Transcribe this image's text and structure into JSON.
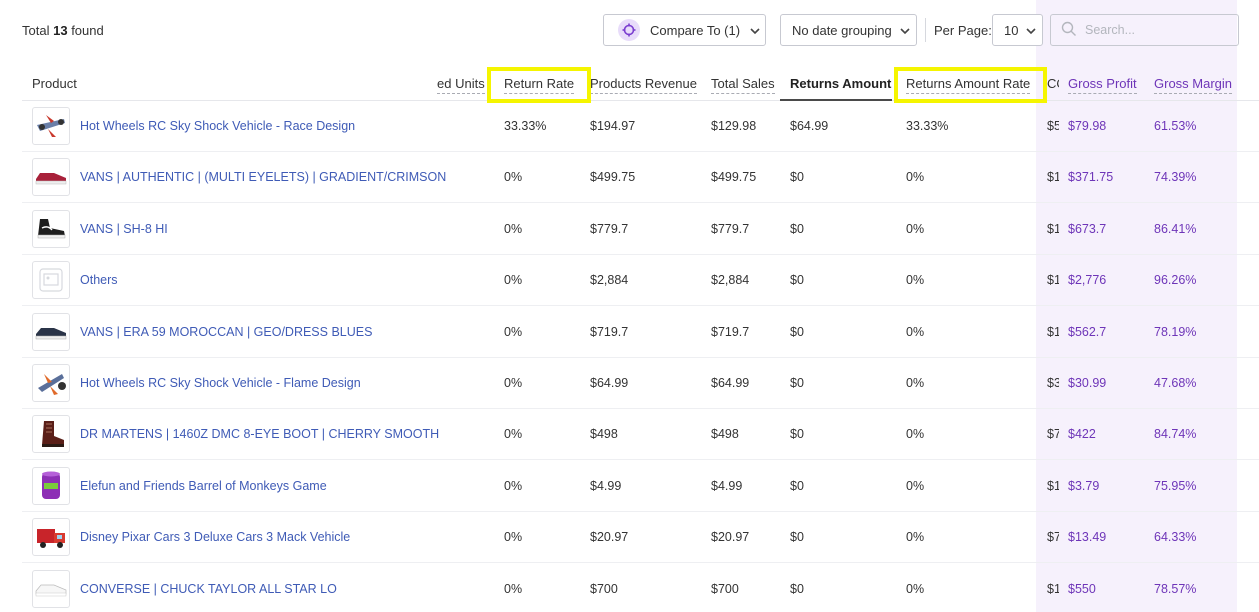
{
  "header": {
    "total_prefix": "Total",
    "total_count": "13",
    "total_suffix": "found",
    "compare_label": "Compare To (1)",
    "date_grouping": "No date grouping",
    "per_page_label": "Per Page:",
    "per_page_value": "10",
    "search_placeholder": "Search..."
  },
  "columns": {
    "product": "Product",
    "ordered_units": "ed Units",
    "return_rate": "Return Rate",
    "products_revenue": "Products Revenue",
    "total_sales": "Total Sales",
    "returns_amount": "Returns Amount",
    "returns_amount_rate": "Returns Amount Rate",
    "cogs": "CO",
    "gross_profit": "Gross Profit",
    "gross_margin": "Gross Margin"
  },
  "rows": [
    {
      "name": "Hot Wheels RC Sky Shock Vehicle - Race Design",
      "return_rate": "33.33%",
      "products_revenue": "$194.97",
      "total_sales": "$129.98",
      "returns_amount": "$64.99",
      "returns_amount_rate": "33.33%",
      "cogs": "$5",
      "gross_profit": "$79.98",
      "gross_margin": "61.53%",
      "thumb": "rc-plane"
    },
    {
      "name": "VANS | AUTHENTIC | (MULTI EYELETS) | GRADIENT/CRIMSON",
      "return_rate": "0%",
      "products_revenue": "$499.75",
      "total_sales": "$499.75",
      "returns_amount": "$0",
      "returns_amount_rate": "0%",
      "cogs": "$1",
      "gross_profit": "$371.75",
      "gross_margin": "74.39%",
      "thumb": "red-shoe"
    },
    {
      "name": "VANS | SH-8 HI",
      "return_rate": "0%",
      "products_revenue": "$779.7",
      "total_sales": "$779.7",
      "returns_amount": "$0",
      "returns_amount_rate": "0%",
      "cogs": "$1",
      "gross_profit": "$673.7",
      "gross_margin": "86.41%",
      "thumb": "hi-shoe"
    },
    {
      "name": "Others",
      "return_rate": "0%",
      "products_revenue": "$2,884",
      "total_sales": "$2,884",
      "returns_amount": "$0",
      "returns_amount_rate": "0%",
      "cogs": "$1",
      "gross_profit": "$2,776",
      "gross_margin": "96.26%",
      "thumb": "placeholder"
    },
    {
      "name": "VANS | ERA 59 MOROCCAN | GEO/DRESS BLUES",
      "return_rate": "0%",
      "products_revenue": "$719.7",
      "total_sales": "$719.7",
      "returns_amount": "$0",
      "returns_amount_rate": "0%",
      "cogs": "$1",
      "gross_profit": "$562.7",
      "gross_margin": "78.19%",
      "thumb": "blue-shoe"
    },
    {
      "name": "Hot Wheels RC Sky Shock Vehicle - Flame Design",
      "return_rate": "0%",
      "products_revenue": "$64.99",
      "total_sales": "$64.99",
      "returns_amount": "$0",
      "returns_amount_rate": "0%",
      "cogs": "$3",
      "gross_profit": "$30.99",
      "gross_margin": "47.68%",
      "thumb": "rc-plane2"
    },
    {
      "name": "DR MARTENS | 1460Z DMC 8-EYE BOOT | CHERRY SMOOTH",
      "return_rate": "0%",
      "products_revenue": "$498",
      "total_sales": "$498",
      "returns_amount": "$0",
      "returns_amount_rate": "0%",
      "cogs": "$7",
      "gross_profit": "$422",
      "gross_margin": "84.74%",
      "thumb": "boot"
    },
    {
      "name": "Elefun and Friends Barrel of Monkeys Game",
      "return_rate": "0%",
      "products_revenue": "$4.99",
      "total_sales": "$4.99",
      "returns_amount": "$0",
      "returns_amount_rate": "0%",
      "cogs": "$1",
      "gross_profit": "$3.79",
      "gross_margin": "75.95%",
      "thumb": "barrel"
    },
    {
      "name": "Disney Pixar Cars 3 Deluxe Cars 3 Mack Vehicle",
      "return_rate": "0%",
      "products_revenue": "$20.97",
      "total_sales": "$20.97",
      "returns_amount": "$0",
      "returns_amount_rate": "0%",
      "cogs": "$7",
      "gross_profit": "$13.49",
      "gross_margin": "64.33%",
      "thumb": "truck"
    },
    {
      "name": "CONVERSE | CHUCK TAYLOR ALL STAR LO",
      "return_rate": "0%",
      "products_revenue": "$700",
      "total_sales": "$700",
      "returns_amount": "$0",
      "returns_amount_rate": "0%",
      "cogs": "$1",
      "gross_profit": "$550",
      "gross_margin": "78.57%",
      "thumb": "white-shoe"
    }
  ],
  "colors": {
    "link": "#3f5bb6",
    "purple": "#6e35b8",
    "highlight": "#f5f500"
  }
}
